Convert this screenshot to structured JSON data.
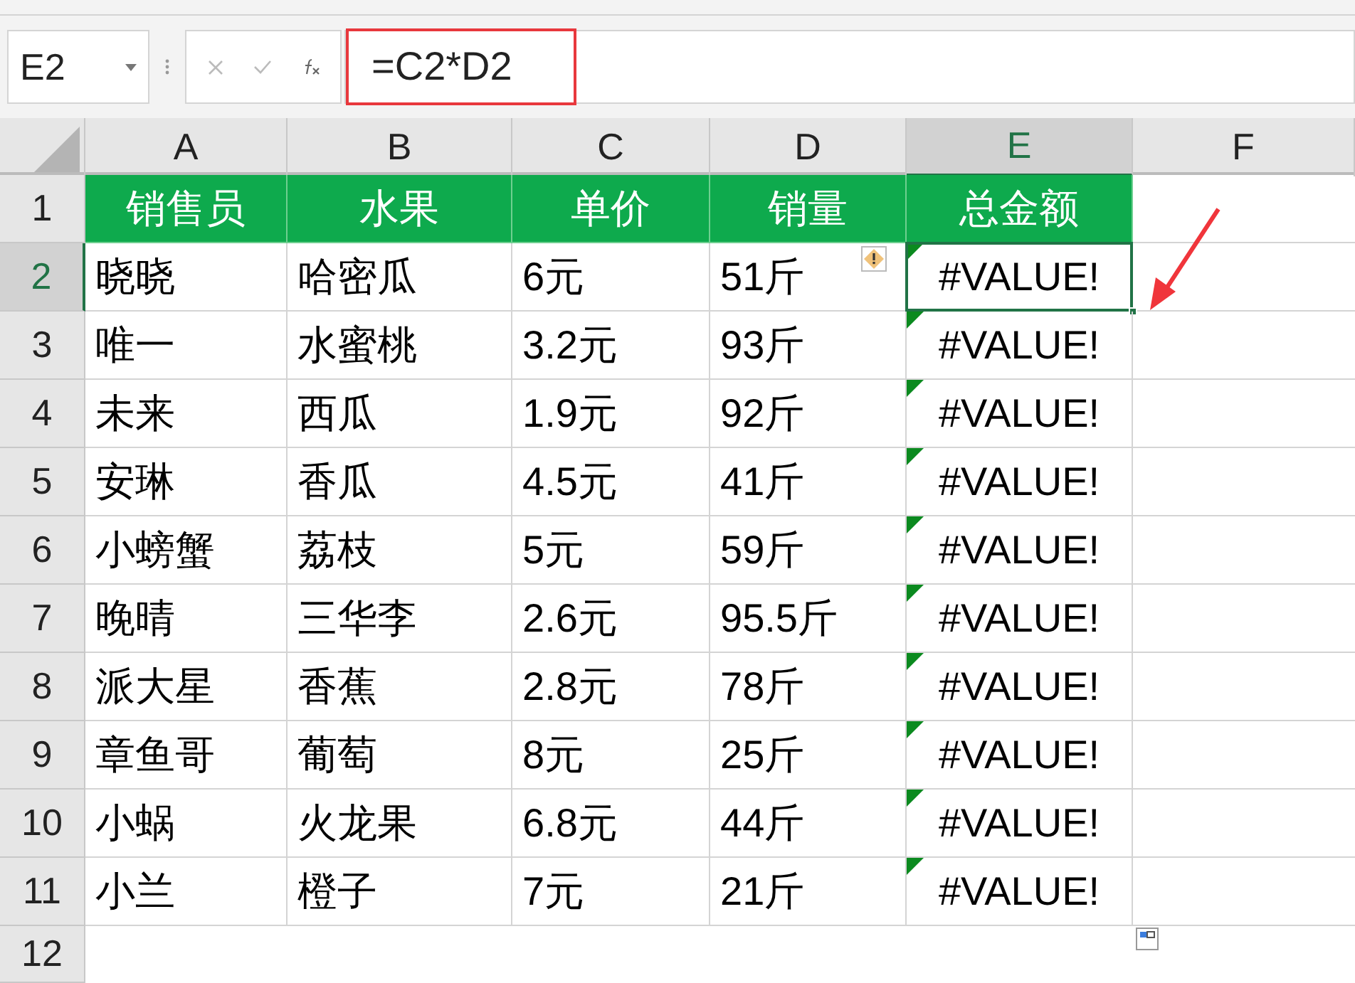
{
  "name_box": {
    "value": "E2"
  },
  "formula_bar": {
    "formula": "=C2*D2",
    "highlighted": true
  },
  "columns": [
    {
      "label": "A",
      "selected": false
    },
    {
      "label": "B",
      "selected": false
    },
    {
      "label": "C",
      "selected": false
    },
    {
      "label": "D",
      "selected": false
    },
    {
      "label": "E",
      "selected": true
    },
    {
      "label": "F",
      "selected": false
    }
  ],
  "rows": [
    {
      "number": "1",
      "selected": false,
      "kind": "header",
      "cells": [
        {
          "text": "销售员"
        },
        {
          "text": "水果"
        },
        {
          "text": "单价"
        },
        {
          "text": "销量"
        },
        {
          "text": "总金额"
        }
      ]
    },
    {
      "number": "2",
      "selected": true,
      "kind": "data",
      "warning": true,
      "cells": [
        {
          "text": "晓晓"
        },
        {
          "text": "哈密瓜"
        },
        {
          "text": "6元"
        },
        {
          "text": "51斤"
        },
        {
          "text": "#VALUE!",
          "error_flag": true,
          "selected": true
        }
      ]
    },
    {
      "number": "3",
      "selected": false,
      "kind": "data",
      "warning": false,
      "cells": [
        {
          "text": "唯一"
        },
        {
          "text": "水蜜桃"
        },
        {
          "text": "3.2元"
        },
        {
          "text": "93斤"
        },
        {
          "text": "#VALUE!",
          "error_flag": true,
          "selected": false
        }
      ]
    },
    {
      "number": "4",
      "selected": false,
      "kind": "data",
      "warning": false,
      "cells": [
        {
          "text": "未来"
        },
        {
          "text": "西瓜"
        },
        {
          "text": "1.9元"
        },
        {
          "text": "92斤"
        },
        {
          "text": "#VALUE!",
          "error_flag": true,
          "selected": false
        }
      ]
    },
    {
      "number": "5",
      "selected": false,
      "kind": "data",
      "warning": false,
      "cells": [
        {
          "text": "安琳"
        },
        {
          "text": "香瓜"
        },
        {
          "text": "4.5元"
        },
        {
          "text": "41斤"
        },
        {
          "text": "#VALUE!",
          "error_flag": true,
          "selected": false
        }
      ]
    },
    {
      "number": "6",
      "selected": false,
      "kind": "data",
      "warning": false,
      "cells": [
        {
          "text": "小螃蟹"
        },
        {
          "text": "荔枝"
        },
        {
          "text": "5元"
        },
        {
          "text": "59斤"
        },
        {
          "text": "#VALUE!",
          "error_flag": true,
          "selected": false
        }
      ]
    },
    {
      "number": "7",
      "selected": false,
      "kind": "data",
      "warning": false,
      "cells": [
        {
          "text": "晚晴"
        },
        {
          "text": "三华李"
        },
        {
          "text": "2.6元"
        },
        {
          "text": "95.5斤"
        },
        {
          "text": "#VALUE!",
          "error_flag": true,
          "selected": false
        }
      ]
    },
    {
      "number": "8",
      "selected": false,
      "kind": "data",
      "warning": false,
      "cells": [
        {
          "text": "派大星"
        },
        {
          "text": "香蕉"
        },
        {
          "text": "2.8元"
        },
        {
          "text": "78斤"
        },
        {
          "text": "#VALUE!",
          "error_flag": true,
          "selected": false
        }
      ]
    },
    {
      "number": "9",
      "selected": false,
      "kind": "data",
      "warning": false,
      "cells": [
        {
          "text": "章鱼哥"
        },
        {
          "text": "葡萄"
        },
        {
          "text": "8元"
        },
        {
          "text": "25斤"
        },
        {
          "text": "#VALUE!",
          "error_flag": true,
          "selected": false
        }
      ]
    },
    {
      "number": "10",
      "selected": false,
      "kind": "data",
      "warning": false,
      "cells": [
        {
          "text": "小蜗"
        },
        {
          "text": "火龙果"
        },
        {
          "text": "6.8元"
        },
        {
          "text": "44斤"
        },
        {
          "text": "#VALUE!",
          "error_flag": true,
          "selected": false
        }
      ]
    },
    {
      "number": "11",
      "selected": false,
      "kind": "data",
      "warning": false,
      "cells": [
        {
          "text": "小兰"
        },
        {
          "text": "橙子"
        },
        {
          "text": "7元"
        },
        {
          "text": "21斤"
        },
        {
          "text": "#VALUE!",
          "error_flag": true,
          "selected": false
        }
      ]
    },
    {
      "number": "12",
      "selected": false,
      "kind": "empty",
      "cells": []
    }
  ]
}
